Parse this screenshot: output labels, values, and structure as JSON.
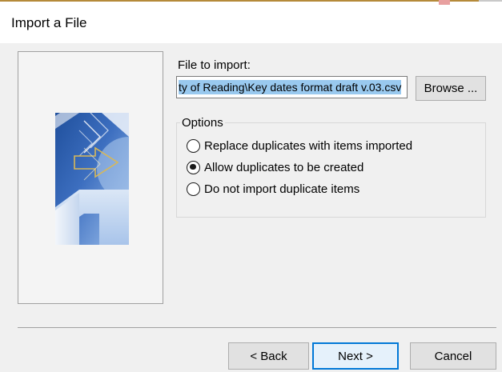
{
  "dialog": {
    "title": "Import a File"
  },
  "file": {
    "label": "File to import:",
    "path_visible": "ty of Reading\\Key dates format draft v.03.csv",
    "browse_label": "Browse ..."
  },
  "options": {
    "legend": "Options",
    "items": [
      {
        "label": "Replace duplicates with items imported",
        "selected": false
      },
      {
        "label": "Allow duplicates to be created",
        "selected": true
      },
      {
        "label": "Do not import duplicate items",
        "selected": false
      }
    ]
  },
  "buttons": {
    "back": "< Back",
    "next": "Next >",
    "cancel": "Cancel"
  },
  "colors": {
    "selection": "#99c9ef",
    "default_button_border": "#0078d7",
    "art_blue_dark": "#2c5daa",
    "art_blue_light": "#9ec0ec",
    "art_arrow_gold": "#d8b858"
  },
  "icons": {
    "wizard_art": "import-wizard-illustration"
  }
}
